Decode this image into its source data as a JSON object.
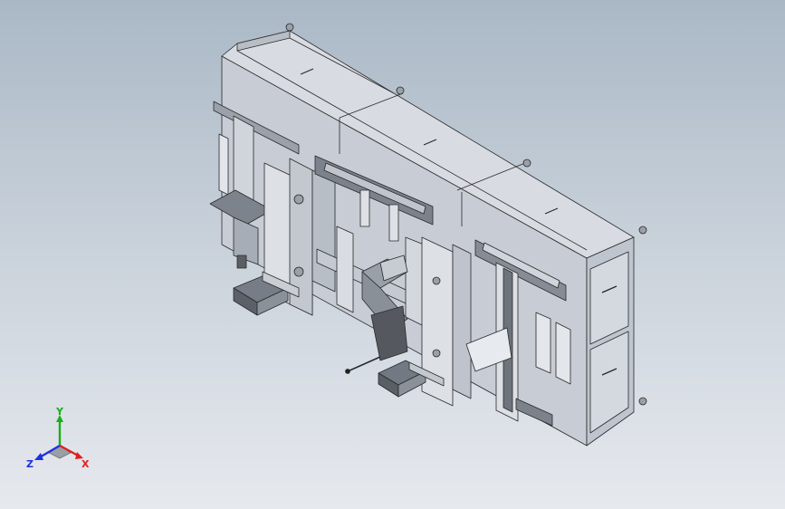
{
  "viewport": {
    "background_top": "#aab8c6",
    "background_bottom": "#e6e9ee"
  },
  "model": {
    "part_fill": "#cfd4dc",
    "part_dark": "#8a8f98",
    "edge_color": "#2a2a2a"
  },
  "triad": {
    "x_label": "X",
    "y_label": "Y",
    "z_label": "Z",
    "x_color": "#e02020",
    "y_color": "#18b018",
    "z_color": "#2030e0"
  }
}
